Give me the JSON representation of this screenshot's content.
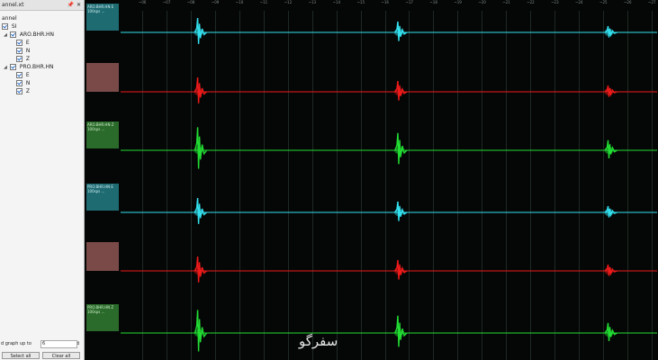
{
  "panel": {
    "title": "annel.xt",
    "pin_glyph": "📌",
    "close_glyph": "✕",
    "tree": [
      {
        "label": "annel",
        "level": 0
      },
      {
        "label": "SI",
        "level": 1
      },
      {
        "label": "ARO.BHR.HN",
        "level": 2
      },
      {
        "label": "E",
        "level": 3
      },
      {
        "label": "N",
        "level": 3
      },
      {
        "label": "Z",
        "level": 3
      },
      {
        "label": "PRO.BHR.HN",
        "level": 2
      },
      {
        "label": "E",
        "level": 3
      },
      {
        "label": "N",
        "level": 3
      },
      {
        "label": "Z",
        "level": 3
      }
    ],
    "graph_count_label": "d graph up to",
    "graph_count_value": "6",
    "select_all_label": "Select all",
    "clear_all_label": "Clear all"
  },
  "plot": {
    "time_ticks": [
      "~06",
      "~07",
      "~08",
      "~09",
      "~10",
      "~11",
      "~12",
      "~13",
      "~14",
      "~15",
      "~16",
      "~17",
      "~18",
      "~19",
      "~20",
      "~21",
      "~22",
      "~23",
      "~24",
      "~25",
      "~26",
      "~27"
    ],
    "traces": [
      {
        "channel": "E",
        "color": "#33e0ee",
        "info": "ARO.BHR.HN E 100sps ..."
      },
      {
        "channel": "N",
        "color": "#ee1a1a",
        "info": ""
      },
      {
        "channel": "Z",
        "color": "#22dd33",
        "info": "ARO.BHR.HN Z 100sps ..."
      },
      {
        "channel": "E",
        "color": "#33e0ee",
        "info": "PRO.BHR.HN E 100sps ..."
      },
      {
        "channel": "N",
        "color": "#ee1a1a",
        "info": ""
      },
      {
        "channel": "Z",
        "color": "#22dd33",
        "info": "PRO.BHR.HN Z 100sps ..."
      }
    ],
    "event_positions_fraction": [
      0.1,
      0.5,
      0.92
    ],
    "watermark": "سفرگو"
  }
}
